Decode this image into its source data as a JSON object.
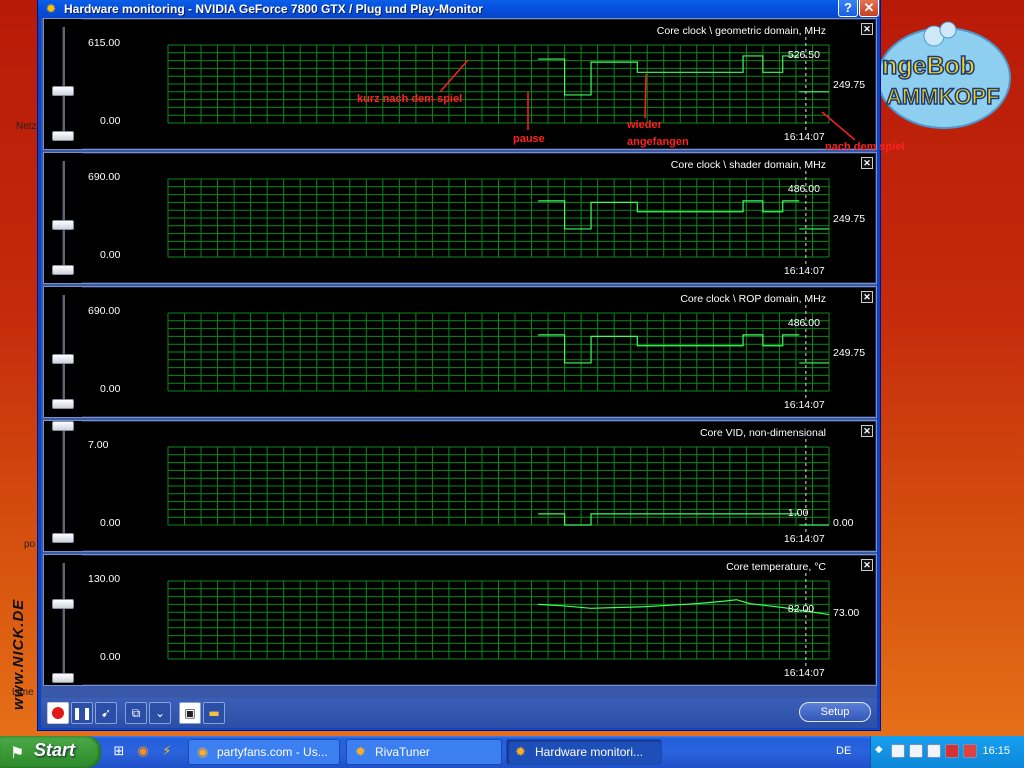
{
  "window": {
    "title": "Hardware monitoring - NVIDIA GeForce 7800 GTX  / Plug und Play-Monitor",
    "help_label": "?",
    "close_label": "✕"
  },
  "desktop": {
    "side_labels": [
      "Netz",
      "po",
      "Lime"
    ],
    "watermark": "www.NICK.DE",
    "logo_text": [
      "ngeBob",
      "AMMKOPF"
    ]
  },
  "graphs": [
    {
      "title": "Core clock \\ geometric domain, MHz",
      "max": "615.00",
      "min": "0.00",
      "current": "526.50",
      "last": "249.75",
      "time": "16:14:07",
      "ymax": 615,
      "data": [
        [
          0.56,
          0.82
        ],
        [
          0.6,
          0.82
        ],
        [
          0.6,
          0.36
        ],
        [
          0.64,
          0.36
        ],
        [
          0.64,
          0.78
        ],
        [
          0.71,
          0.78
        ],
        [
          0.71,
          0.65
        ],
        [
          0.87,
          0.65
        ],
        [
          0.87,
          0.86
        ],
        [
          0.9,
          0.86
        ],
        [
          0.9,
          0.65
        ],
        [
          0.93,
          0.65
        ],
        [
          0.93,
          0.86
        ],
        [
          0.955,
          0.86
        ]
      ],
      "tail": [
        [
          0.955,
          0.4
        ],
        [
          1,
          0.4
        ]
      ]
    },
    {
      "title": "Core clock \\ shader domain, MHz",
      "max": "690.00",
      "min": "0.00",
      "current": "486.00",
      "last": "249.75",
      "time": "16:14:07",
      "ymax": 690,
      "data": [
        [
          0.56,
          0.72
        ],
        [
          0.6,
          0.72
        ],
        [
          0.6,
          0.36
        ],
        [
          0.64,
          0.36
        ],
        [
          0.64,
          0.7
        ],
        [
          0.71,
          0.7
        ],
        [
          0.71,
          0.58
        ],
        [
          0.87,
          0.58
        ],
        [
          0.87,
          0.72
        ],
        [
          0.9,
          0.72
        ],
        [
          0.9,
          0.58
        ],
        [
          0.93,
          0.58
        ],
        [
          0.93,
          0.72
        ],
        [
          0.955,
          0.72
        ]
      ],
      "tail": [
        [
          0.955,
          0.36
        ],
        [
          1,
          0.36
        ]
      ]
    },
    {
      "title": "Core clock \\ ROP domain, MHz",
      "max": "690.00",
      "min": "0.00",
      "current": "486.00",
      "last": "249.75",
      "time": "16:14:07",
      "ymax": 690,
      "data": [
        [
          0.56,
          0.72
        ],
        [
          0.6,
          0.72
        ],
        [
          0.6,
          0.36
        ],
        [
          0.64,
          0.36
        ],
        [
          0.64,
          0.7
        ],
        [
          0.71,
          0.7
        ],
        [
          0.71,
          0.58
        ],
        [
          0.87,
          0.58
        ],
        [
          0.87,
          0.72
        ],
        [
          0.9,
          0.72
        ],
        [
          0.9,
          0.58
        ],
        [
          0.93,
          0.58
        ],
        [
          0.93,
          0.72
        ],
        [
          0.955,
          0.72
        ]
      ],
      "tail": [
        [
          0.955,
          0.36
        ],
        [
          1,
          0.36
        ]
      ]
    },
    {
      "title": "Core VID, non-dimensional",
      "max": "7.00",
      "min": "0.00",
      "current": "1.00",
      "last": "0.00",
      "time": "16:14:07",
      "ymax": 7,
      "data": [
        [
          0.56,
          0.143
        ],
        [
          0.6,
          0.143
        ],
        [
          0.6,
          0
        ],
        [
          0.64,
          0
        ],
        [
          0.64,
          0.143
        ],
        [
          0.955,
          0.143
        ]
      ],
      "tail": [
        [
          0.955,
          0
        ],
        [
          1,
          0
        ]
      ]
    },
    {
      "title": "Core temperature, °C",
      "max": "130.00",
      "min": "0.00",
      "current": "82.00",
      "last": "73.00",
      "time": "16:14:07",
      "ymax": 130,
      "data": [
        [
          0.56,
          0.7
        ],
        [
          0.6,
          0.68
        ],
        [
          0.64,
          0.65
        ],
        [
          0.68,
          0.66
        ],
        [
          0.72,
          0.67
        ],
        [
          0.76,
          0.69
        ],
        [
          0.8,
          0.71
        ],
        [
          0.84,
          0.74
        ],
        [
          0.86,
          0.76
        ],
        [
          0.88,
          0.71
        ],
        [
          0.9,
          0.69
        ],
        [
          0.93,
          0.66
        ],
        [
          0.96,
          0.62
        ],
        [
          1,
          0.57
        ]
      ],
      "tail": []
    }
  ],
  "annotations": [
    "kurz nach dem spiel",
    "pause",
    "wieder",
    "angefangen",
    "nach dem spiel"
  ],
  "toolbar": {
    "setup_label": "Setup"
  },
  "taskbar": {
    "start_label": "Start",
    "tasks": [
      "partyfans.com - Us...",
      "RivaTuner",
      "Hardware monitori..."
    ],
    "lang": "DE",
    "clock": "16:15"
  }
}
